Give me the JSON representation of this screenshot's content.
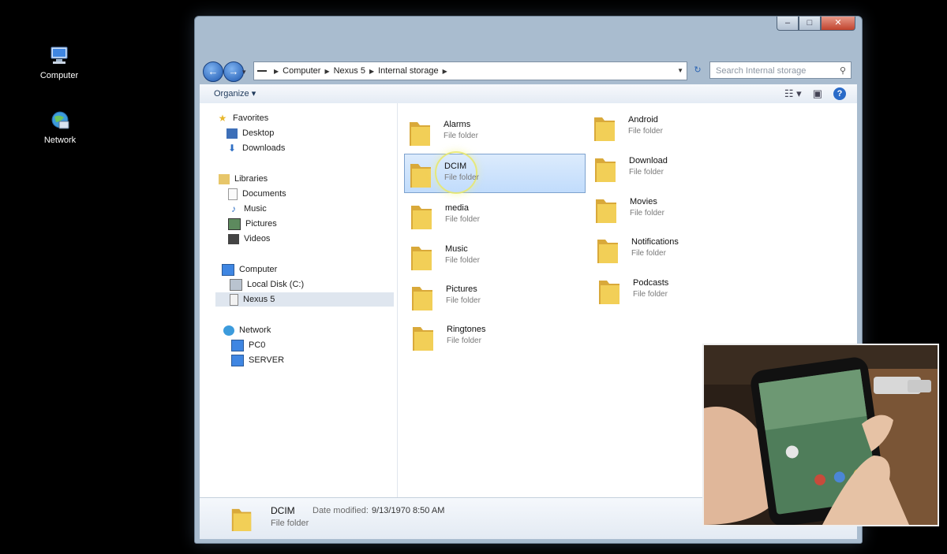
{
  "desktop": {
    "icons": [
      {
        "label": "Computer",
        "icon": "computer-icon"
      },
      {
        "label": "Network",
        "icon": "network-icon"
      }
    ]
  },
  "window": {
    "controls": {
      "minimize": "–",
      "maximize": "□",
      "close": "✕"
    },
    "breadcrumb": [
      "Computer",
      "Nexus 5",
      "Internal storage"
    ],
    "search_placeholder": "Search Internal storage",
    "toolbar": {
      "organize": "Organize ▾"
    },
    "nav": {
      "favorites": {
        "label": "Favorites",
        "items": [
          "Desktop",
          "Downloads"
        ]
      },
      "libraries": {
        "label": "Libraries",
        "items": [
          "Documents",
          "Music",
          "Pictures",
          "Videos"
        ]
      },
      "computer": {
        "label": "Computer",
        "items": [
          "Local Disk (C:)",
          "Nexus 5"
        ]
      },
      "network": {
        "label": "Network",
        "items": [
          "PC0",
          "SERVER"
        ]
      },
      "selected": "Nexus 5"
    },
    "folders": [
      {
        "name": "Alarms",
        "type": "File folder"
      },
      {
        "name": "DCIM",
        "type": "File folder",
        "selected": true
      },
      {
        "name": "media",
        "type": "File folder"
      },
      {
        "name": "Music",
        "type": "File folder"
      },
      {
        "name": "Pictures",
        "type": "File folder"
      },
      {
        "name": "Ringtones",
        "type": "File folder"
      },
      {
        "name": "Android",
        "type": "File folder"
      },
      {
        "name": "Download",
        "type": "File folder"
      },
      {
        "name": "Movies",
        "type": "File folder"
      },
      {
        "name": "Notifications",
        "type": "File folder"
      },
      {
        "name": "Podcasts",
        "type": "File folder"
      }
    ],
    "details": {
      "name": "DCIM",
      "type": "File folder",
      "modified_label": "Date modified:",
      "modified_value": "9/13/1970 8:50 AM"
    }
  },
  "colors": {
    "accent": "#2a6bc8",
    "selection": "#c1dcfc",
    "folder": "#f2cf57"
  }
}
